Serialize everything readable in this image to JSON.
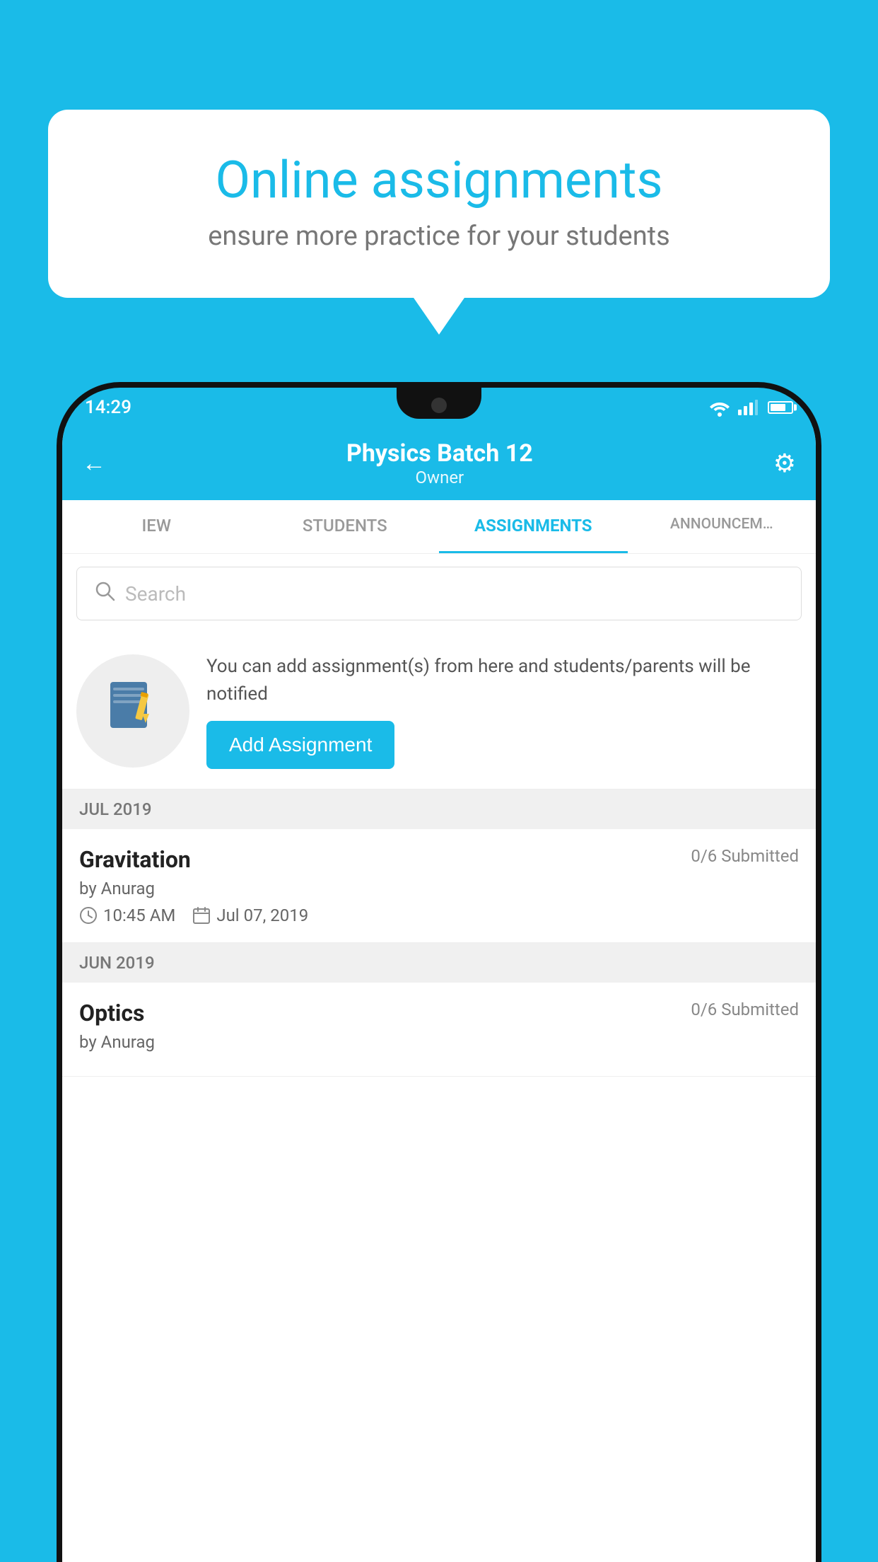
{
  "background": {
    "color": "#1ABBE8"
  },
  "speech_bubble": {
    "title": "Online assignments",
    "subtitle": "ensure more practice for your students"
  },
  "phone": {
    "status_bar": {
      "time": "14:29"
    },
    "header": {
      "title": "Physics Batch 12",
      "subtitle": "Owner",
      "back_label": "←",
      "settings_label": "⚙"
    },
    "tabs": [
      {
        "label": "IEW",
        "active": false
      },
      {
        "label": "STUDENTS",
        "active": false
      },
      {
        "label": "ASSIGNMENTS",
        "active": true
      },
      {
        "label": "ANNOUNCEM…",
        "active": false
      }
    ],
    "search": {
      "placeholder": "Search"
    },
    "promo": {
      "text": "You can add assignment(s) from here and students/parents will be notified",
      "button_label": "Add Assignment"
    },
    "sections": [
      {
        "label": "JUL 2019",
        "assignments": [
          {
            "name": "Gravitation",
            "status": "0/6 Submitted",
            "author": "by Anurag",
            "time": "10:45 AM",
            "date": "Jul 07, 2019"
          }
        ]
      },
      {
        "label": "JUN 2019",
        "assignments": [
          {
            "name": "Optics",
            "status": "0/6 Submitted",
            "author": "by Anurag",
            "time": "",
            "date": ""
          }
        ]
      }
    ]
  }
}
